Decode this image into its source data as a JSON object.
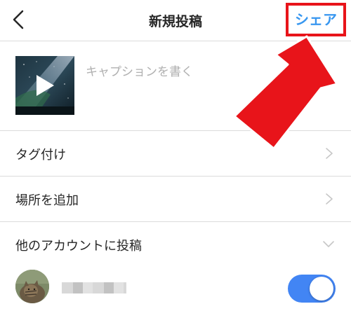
{
  "header": {
    "title": "新規投稿",
    "share_label": "シェア",
    "back_icon": "chevron-left-icon"
  },
  "caption": {
    "placeholder": "キャプションを書く",
    "value": ""
  },
  "rows": [
    {
      "label": "タグ付け",
      "icon": "chevron-right-icon"
    },
    {
      "label": "場所を追加",
      "icon": "chevron-right-icon"
    },
    {
      "label": "他のアカウントに投稿",
      "icon": "chevron-down-icon"
    }
  ],
  "account": {
    "toggle_on": true
  },
  "colors": {
    "accent": "#3897f0",
    "toggle": "#4285f4",
    "highlight": "#e8141a",
    "divider": "#dbdbdb"
  }
}
